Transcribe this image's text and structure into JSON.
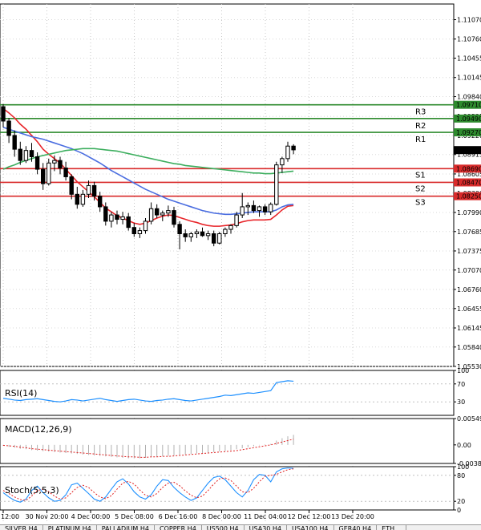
{
  "chart_data": [
    {
      "type": "candlestick",
      "symbol": "",
      "y_ticks": [
        1.1107,
        1.1076,
        1.10455,
        1.10145,
        1.0984,
        1.09525,
        1.0922,
        1.08915,
        1.08605,
        1.083,
        1.0799,
        1.07685,
        1.07375,
        1.0707,
        1.0676,
        1.06455,
        1.06145,
        1.0584,
        1.0553
      ],
      "ylim": [
        1.0553,
        1.1132
      ],
      "x_tick_labels": [
        "12:00",
        "30 Nov 20:00",
        "4 Dec 00:00",
        "5 Dec 08:00",
        "6 Dec 16:00",
        "8 Dec 00:00",
        "11 Dec 04:00",
        "12 Dec 12:00",
        "13 Dec 20:00"
      ],
      "current_price": 1.08986,
      "levels": [
        {
          "name": "R3",
          "value": 1.0971,
          "kind": "resistance"
        },
        {
          "name": "R2",
          "value": 1.0949,
          "kind": "resistance"
        },
        {
          "name": "R1",
          "value": 1.0927,
          "kind": "resistance"
        },
        {
          "name": "S1",
          "value": 1.0869,
          "kind": "support"
        },
        {
          "name": "S2",
          "value": 1.0847,
          "kind": "support"
        },
        {
          "name": "S3",
          "value": 1.0825,
          "kind": "support"
        }
      ],
      "candles": [
        [
          1.0968,
          1.0972,
          1.0935,
          1.0945
        ],
        [
          1.0945,
          1.095,
          1.091,
          1.0922
        ],
        [
          1.0922,
          1.093,
          1.0888,
          1.09
        ],
        [
          1.09,
          1.0912,
          1.0875,
          1.0882
        ],
        [
          1.0882,
          1.0905,
          1.0878,
          1.0898
        ],
        [
          1.0898,
          1.091,
          1.088,
          1.0888
        ],
        [
          1.0888,
          1.0895,
          1.086,
          1.0868
        ],
        [
          1.0868,
          1.0878,
          1.0835,
          1.0845
        ],
        [
          1.0845,
          1.0885,
          1.0842,
          1.0878
        ],
        [
          1.0878,
          1.089,
          1.0865,
          1.0882
        ],
        [
          1.0882,
          1.0888,
          1.086,
          1.087
        ],
        [
          1.087,
          1.088,
          1.085,
          1.0856
        ],
        [
          1.0856,
          1.086,
          1.082,
          1.0828
        ],
        [
          1.0828,
          1.084,
          1.0805,
          1.0812
        ],
        [
          1.0812,
          1.0835,
          1.0808,
          1.0828
        ],
        [
          1.0828,
          1.085,
          1.0822,
          1.0842
        ],
        [
          1.0842,
          1.0848,
          1.0818,
          1.0825
        ],
        [
          1.0825,
          1.0832,
          1.08,
          1.0808
        ],
        [
          1.0808,
          1.0815,
          1.0778,
          1.0785
        ],
        [
          1.0785,
          1.08,
          1.0775,
          1.0795
        ],
        [
          1.0795,
          1.0802,
          1.078,
          1.0788
        ],
        [
          1.0788,
          1.08,
          1.078,
          1.0792
        ],
        [
          1.0792,
          1.0798,
          1.077,
          1.0775
        ],
        [
          1.0775,
          1.0782,
          1.076,
          1.0765
        ],
        [
          1.0765,
          1.0775,
          1.0758,
          1.077
        ],
        [
          1.077,
          1.079,
          1.0765,
          1.0785
        ],
        [
          1.0785,
          1.0815,
          1.078,
          1.0805
        ],
        [
          1.0805,
          1.0812,
          1.079,
          1.0795
        ],
        [
          1.0795,
          1.0802,
          1.0785,
          1.0798
        ],
        [
          1.0798,
          1.081,
          1.0792,
          1.0802
        ],
        [
          1.0802,
          1.0808,
          1.0775,
          1.078
        ],
        [
          1.078,
          1.0785,
          1.074,
          1.0765
        ],
        [
          1.0765,
          1.0772,
          1.0752,
          1.076
        ],
        [
          1.076,
          1.0768,
          1.0752,
          1.0765
        ],
        [
          1.0765,
          1.0772,
          1.0758,
          1.0768
        ],
        [
          1.0768,
          1.0775,
          1.076,
          1.0762
        ],
        [
          1.0762,
          1.077,
          1.0755,
          1.0765
        ],
        [
          1.0765,
          1.077,
          1.0745,
          1.075
        ],
        [
          1.075,
          1.0768,
          1.0748,
          1.0765
        ],
        [
          1.0765,
          1.0775,
          1.076,
          1.0772
        ],
        [
          1.0772,
          1.078,
          1.0765,
          1.0778
        ],
        [
          1.0778,
          1.08,
          1.0775,
          1.0795
        ],
        [
          1.0795,
          1.083,
          1.079,
          1.0808
        ],
        [
          1.0808,
          1.0815,
          1.0795,
          1.081
        ],
        [
          1.081,
          1.0818,
          1.0798,
          1.0802
        ],
        [
          1.0802,
          1.081,
          1.0792,
          1.0808
        ],
        [
          1.0808,
          1.0812,
          1.0795,
          1.08
        ],
        [
          1.08,
          1.0815,
          1.0795,
          1.0812
        ],
        [
          1.0812,
          1.088,
          1.081,
          1.0875
        ],
        [
          1.0875,
          1.0888,
          1.0862,
          1.0885
        ],
        [
          1.0885,
          1.0912,
          1.088,
          1.0905
        ],
        [
          1.0905,
          1.0908,
          1.0892,
          1.0899
        ]
      ],
      "moving_averages": [
        {
          "color": "#e8262b",
          "values": [
            1.0965,
            1.0958,
            1.095,
            1.094,
            1.0932,
            1.0922,
            1.0912,
            1.09,
            1.0892,
            1.0885,
            1.0878,
            1.0868,
            1.0858,
            1.0848,
            1.084,
            1.0832,
            1.0824,
            1.0815,
            1.0806,
            1.08,
            1.0794,
            1.079,
            1.0786,
            1.0782,
            1.078,
            1.0782,
            1.0786,
            1.079,
            1.0793,
            1.0795,
            1.0794,
            1.0791,
            1.0788,
            1.0785,
            1.0783,
            1.078,
            1.0778,
            1.0777,
            1.0777,
            1.0778,
            1.0779,
            1.0781,
            1.0784,
            1.0786,
            1.0787,
            1.0787,
            1.0787,
            1.0788,
            1.0795,
            1.0803,
            1.0809,
            1.081
          ]
        },
        {
          "color": "#4a6de0",
          "values": [
            1.0935,
            1.0932,
            1.0929,
            1.0926,
            1.0923,
            1.092,
            1.0918,
            1.0916,
            1.0913,
            1.091,
            1.0907,
            1.0904,
            1.0901,
            1.0897,
            1.0893,
            1.0888,
            1.0883,
            1.0878,
            1.0872,
            1.0866,
            1.0861,
            1.0856,
            1.0851,
            1.0846,
            1.0841,
            1.0836,
            1.0832,
            1.0828,
            1.0824,
            1.082,
            1.0817,
            1.0814,
            1.0811,
            1.0808,
            1.0805,
            1.0802,
            1.08,
            1.0798,
            1.0797,
            1.0796,
            1.0796,
            1.0797,
            1.0798,
            1.0799,
            1.08,
            1.08,
            1.08,
            1.08,
            1.0803,
            1.0808,
            1.0811,
            1.0812
          ]
        },
        {
          "color": "#3cae5e",
          "values": [
            1.0868,
            1.0872,
            1.0875,
            1.0879,
            1.0882,
            1.0885,
            1.0888,
            1.089,
            1.0892,
            1.0894,
            1.0896,
            1.0898,
            1.0899,
            1.09,
            1.0901,
            1.0901,
            1.0901,
            1.09,
            1.0899,
            1.0898,
            1.0897,
            1.0895,
            1.0893,
            1.0891,
            1.0889,
            1.0887,
            1.0885,
            1.0883,
            1.0881,
            1.0879,
            1.0877,
            1.0876,
            1.0874,
            1.0873,
            1.0872,
            1.0871,
            1.087,
            1.0869,
            1.0868,
            1.0867,
            1.0866,
            1.0865,
            1.0864,
            1.0863,
            1.0862,
            1.0862,
            1.0861,
            1.0861,
            1.0862,
            1.0863,
            1.0864,
            1.0865
          ]
        }
      ]
    },
    {
      "type": "line",
      "title": "RSI(14)",
      "y_ticks": [
        100,
        70,
        30
      ],
      "ylim": [
        0,
        100
      ],
      "values": [
        38,
        36,
        34,
        33,
        35,
        36,
        37,
        35,
        33,
        31,
        30,
        32,
        35,
        34,
        32,
        34,
        36,
        38,
        35,
        33,
        31,
        33,
        35,
        36,
        34,
        32,
        31,
        33,
        34,
        36,
        37,
        35,
        33,
        32,
        34,
        36,
        38,
        40,
        42,
        45,
        44,
        46,
        48,
        50,
        49,
        51,
        53,
        55,
        73,
        75,
        77,
        76
      ]
    },
    {
      "type": "histogram",
      "title": "MACD(12,26,9)",
      "y_ticks": [
        0.005491,
        0.0,
        -0.003874
      ],
      "ylim": [
        -0.003874,
        0.005491
      ],
      "histogram": [
        -0.0002,
        -0.0004,
        -0.0006,
        -0.0008,
        -0.0009,
        -0.0011,
        -0.0012,
        -0.0013,
        -0.0014,
        -0.0015,
        -0.0016,
        -0.0017,
        -0.0018,
        -0.0019,
        -0.002,
        -0.0021,
        -0.0022,
        -0.0023,
        -0.0024,
        -0.0025,
        -0.0026,
        -0.0027,
        -0.0028,
        -0.0028,
        -0.0028,
        -0.0027,
        -0.0026,
        -0.0025,
        -0.0024,
        -0.0023,
        -0.0022,
        -0.0021,
        -0.002,
        -0.0019,
        -0.0018,
        -0.0017,
        -0.0016,
        -0.0015,
        -0.0014,
        -0.0013,
        -0.0011,
        -0.0009,
        -0.0007,
        -0.0005,
        -0.0003,
        -0.0001,
        0.0001,
        0.0002,
        0.0009,
        0.0014,
        0.0018,
        0.0021
      ],
      "signal": [
        -0.0001,
        -0.0002,
        -0.0003,
        -0.0005,
        -0.0006,
        -0.0008,
        -0.0009,
        -0.001,
        -0.0011,
        -0.0012,
        -0.0013,
        -0.0014,
        -0.0015,
        -0.0016,
        -0.0017,
        -0.0018,
        -0.0019,
        -0.002,
        -0.0021,
        -0.0022,
        -0.0023,
        -0.0024,
        -0.0025,
        -0.0025,
        -0.0026,
        -0.0026,
        -0.0025,
        -0.0025,
        -0.0024,
        -0.0024,
        -0.0023,
        -0.0022,
        -0.0021,
        -0.002,
        -0.0019,
        -0.0018,
        -0.0017,
        -0.0016,
        -0.0015,
        -0.0014,
        -0.0013,
        -0.0012,
        -0.001,
        -0.0008,
        -0.0006,
        -0.0004,
        -0.0002,
        0.0,
        0.0003,
        0.0006,
        0.0009,
        0.0012
      ]
    },
    {
      "type": "line",
      "title": "Stoch(5,5,3)",
      "y_ticks": [
        100,
        80,
        20,
        0
      ],
      "ylim": [
        0,
        100
      ],
      "main": [
        40,
        30,
        22,
        18,
        25,
        45,
        55,
        40,
        28,
        20,
        22,
        35,
        58,
        62,
        50,
        38,
        25,
        20,
        30,
        48,
        65,
        72,
        60,
        42,
        30,
        25,
        35,
        55,
        70,
        68,
        52,
        40,
        30,
        22,
        28,
        45,
        62,
        75,
        78,
        70,
        55,
        40,
        30,
        45,
        70,
        82,
        80,
        65,
        88,
        95,
        97,
        96
      ],
      "signal": [
        45,
        38,
        30,
        24,
        22,
        32,
        45,
        48,
        42,
        32,
        25,
        28,
        40,
        52,
        57,
        52,
        40,
        30,
        26,
        33,
        48,
        62,
        66,
        60,
        46,
        34,
        30,
        38,
        52,
        62,
        64,
        56,
        44,
        34,
        28,
        32,
        45,
        60,
        72,
        74,
        68,
        55,
        42,
        40,
        50,
        65,
        78,
        80,
        82,
        88,
        93,
        95
      ]
    }
  ],
  "tabs": [
    "SILVER,H4",
    "PLATINUM,H4",
    "PALLADIUM,H4",
    "COPPER,H4",
    "US500,H4",
    "USA30,H4",
    "USA100,H4",
    "GER40,H4",
    "ETH..."
  ]
}
